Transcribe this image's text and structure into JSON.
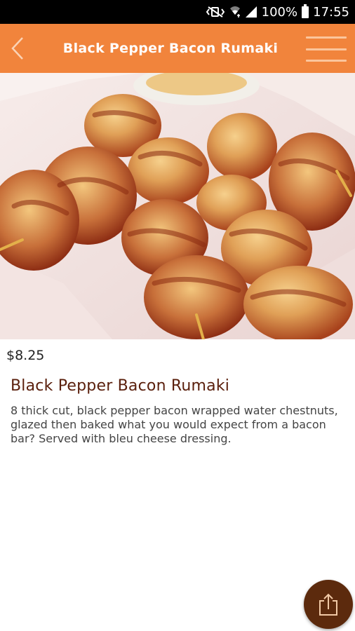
{
  "status_bar": {
    "battery": "100%",
    "time": "17:55",
    "icons": [
      "mute-vibrate-icon",
      "wifi-icon",
      "signal-icon",
      "battery-icon"
    ]
  },
  "app_bar": {
    "title": "Black Pepper Bacon Rumaki",
    "background_color": "#f1843c",
    "back_icon": "chevron-left-icon",
    "menu_icon": "hamburger-menu-icon"
  },
  "item": {
    "image": "bacon-rumaki-photo",
    "price": "$8.25",
    "name": "Black Pepper Bacon Rumaki",
    "description": "8 thick cut, black pepper bacon wrapped water chestnuts, glazed then baked what you would expect from a bacon bar? Served with bleu cheese dressing."
  },
  "fab": {
    "icon": "share-upload-icon",
    "color": "#5c2a0d"
  }
}
